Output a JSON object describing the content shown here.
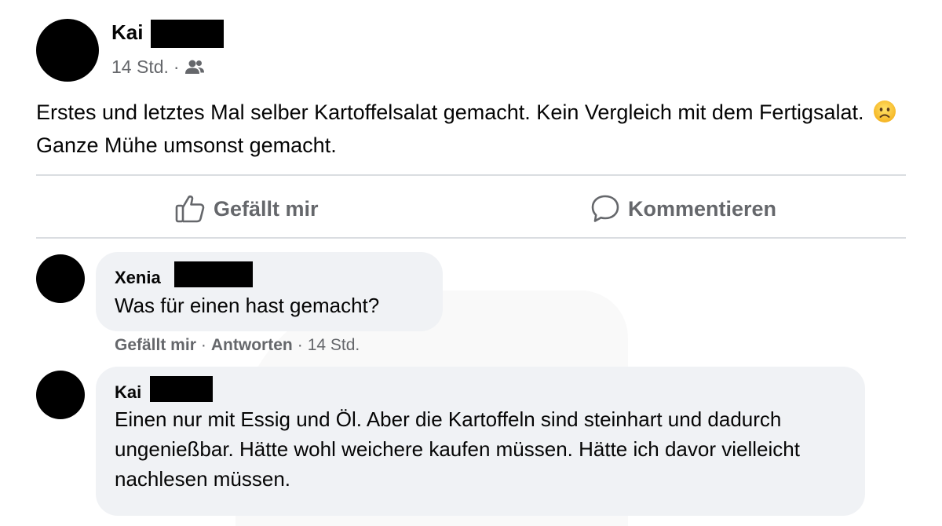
{
  "post": {
    "author_name": "Kai",
    "time": "14 Std.",
    "separator": "·",
    "audience_icon": "friends-icon",
    "text_part1": "Erstes und letztes Mal selber Kartoffelsalat gemacht. Kein Vergleich mit dem Fertigsalat.",
    "emoji": "frowning-face",
    "text_part2": "Ganze Mühe umsonst gemacht."
  },
  "actions": {
    "like_label": "Gefällt mir",
    "comment_label": "Kommentieren"
  },
  "comments": [
    {
      "author": "Xenia",
      "text": "Was für einen hast gemacht?",
      "like_label": "Gefällt mir",
      "reply_label": "Antworten",
      "time": "14 Std."
    },
    {
      "author": "Kai",
      "text": "Einen nur mit Essig und Öl. Aber die Kartoffeln sind steinhart und dadurch ungenießbar. Hätte wohl weichere kaufen müssen. Hätte ich davor vielleicht nachlesen müssen."
    }
  ],
  "colors": {
    "text": "#050505",
    "secondary": "#65676b",
    "bubble": "#f0f2f5",
    "divider": "#dadde1"
  }
}
